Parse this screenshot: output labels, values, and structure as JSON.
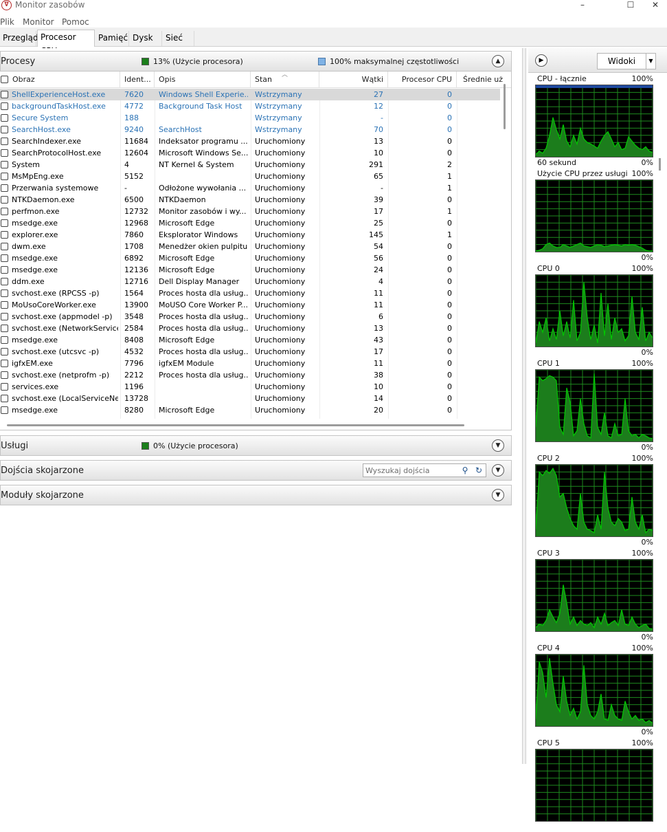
{
  "window": {
    "title": "Monitor zasobów",
    "minimize": "–",
    "maximize": "☐",
    "close": "✕",
    "icon_glyph": "∇"
  },
  "menu": [
    "Plik",
    "Monitor",
    "Pomoc"
  ],
  "tabs": [
    "Przegląd",
    "Procesor CPU",
    "Pamięć",
    "Dysk",
    "Sieć"
  ],
  "active_tab": "Procesor CPU",
  "processes": {
    "title": "Procesy",
    "cpu_usage": "13% (Użycie procesora)",
    "max_freq": "100% maksymalnej częstotliwości",
    "columns": [
      "Obraz",
      "Ident...",
      "Opis",
      "Stan",
      "Wątki",
      "Procesor CPU",
      "Średnie uż"
    ],
    "rows": [
      {
        "name": "ShellExperienceHost.exe",
        "pid": "7620",
        "desc": "Windows Shell Experie...",
        "state": "Wstrzymany",
        "threads": "27",
        "cpu": "0",
        "suspended": true,
        "selected": true
      },
      {
        "name": "backgroundTaskHost.exe",
        "pid": "4772",
        "desc": "Background Task Host",
        "state": "Wstrzymany",
        "threads": "12",
        "cpu": "0",
        "suspended": true
      },
      {
        "name": "Secure System",
        "pid": "188",
        "desc": "",
        "state": "Wstrzymany",
        "threads": "-",
        "cpu": "0",
        "suspended": true
      },
      {
        "name": "SearchHost.exe",
        "pid": "9240",
        "desc": "SearchHost",
        "state": "Wstrzymany",
        "threads": "70",
        "cpu": "0",
        "suspended": true
      },
      {
        "name": "SearchIndexer.exe",
        "pid": "11684",
        "desc": "Indeksator programu ...",
        "state": "Uruchomiony",
        "threads": "13",
        "cpu": "0"
      },
      {
        "name": "SearchProtocolHost.exe",
        "pid": "12604",
        "desc": "Microsoft Windows Se...",
        "state": "Uruchomiony",
        "threads": "10",
        "cpu": "0"
      },
      {
        "name": "System",
        "pid": "4",
        "desc": "NT Kernel & System",
        "state": "Uruchomiony",
        "threads": "291",
        "cpu": "2"
      },
      {
        "name": "MsMpEng.exe",
        "pid": "5152",
        "desc": "",
        "state": "Uruchomiony",
        "threads": "65",
        "cpu": "1"
      },
      {
        "name": "Przerwania systemowe",
        "pid": "-",
        "desc": "Odłożone wywołania ...",
        "state": "Uruchomiony",
        "threads": "-",
        "cpu": "1"
      },
      {
        "name": "NTKDaemon.exe",
        "pid": "6500",
        "desc": "NTKDaemon",
        "state": "Uruchomiony",
        "threads": "39",
        "cpu": "0"
      },
      {
        "name": "perfmon.exe",
        "pid": "12732",
        "desc": "Monitor zasobów i wy...",
        "state": "Uruchomiony",
        "threads": "17",
        "cpu": "1"
      },
      {
        "name": "msedge.exe",
        "pid": "12968",
        "desc": "Microsoft Edge",
        "state": "Uruchomiony",
        "threads": "25",
        "cpu": "0"
      },
      {
        "name": "explorer.exe",
        "pid": "7860",
        "desc": "Eksplorator Windows",
        "state": "Uruchomiony",
        "threads": "145",
        "cpu": "1"
      },
      {
        "name": "dwm.exe",
        "pid": "1708",
        "desc": "Menedżer okien pulpitu",
        "state": "Uruchomiony",
        "threads": "54",
        "cpu": "0"
      },
      {
        "name": "msedge.exe",
        "pid": "6892",
        "desc": "Microsoft Edge",
        "state": "Uruchomiony",
        "threads": "56",
        "cpu": "0"
      },
      {
        "name": "msedge.exe",
        "pid": "12136",
        "desc": "Microsoft Edge",
        "state": "Uruchomiony",
        "threads": "24",
        "cpu": "0"
      },
      {
        "name": "ddm.exe",
        "pid": "12716",
        "desc": "Dell Display Manager",
        "state": "Uruchomiony",
        "threads": "4",
        "cpu": "0"
      },
      {
        "name": "svchost.exe (RPCSS -p)",
        "pid": "1564",
        "desc": "Proces hosta dla usług...",
        "state": "Uruchomiony",
        "threads": "11",
        "cpu": "0"
      },
      {
        "name": "MoUsoCoreWorker.exe",
        "pid": "13900",
        "desc": "MoUSO Core Worker P...",
        "state": "Uruchomiony",
        "threads": "11",
        "cpu": "0"
      },
      {
        "name": "svchost.exe (appmodel -p)",
        "pid": "3548",
        "desc": "Proces hosta dla usług...",
        "state": "Uruchomiony",
        "threads": "6",
        "cpu": "0"
      },
      {
        "name": "svchost.exe (NetworkService...",
        "pid": "2584",
        "desc": "Proces hosta dla usług...",
        "state": "Uruchomiony",
        "threads": "13",
        "cpu": "0"
      },
      {
        "name": "msedge.exe",
        "pid": "8408",
        "desc": "Microsoft Edge",
        "state": "Uruchomiony",
        "threads": "43",
        "cpu": "0"
      },
      {
        "name": "svchost.exe (utcsvc -p)",
        "pid": "4532",
        "desc": "Proces hosta dla usług...",
        "state": "Uruchomiony",
        "threads": "17",
        "cpu": "0"
      },
      {
        "name": "igfxEM.exe",
        "pid": "7796",
        "desc": "igfxEM Module",
        "state": "Uruchomiony",
        "threads": "11",
        "cpu": "0"
      },
      {
        "name": "svchost.exe (netprofm -p)",
        "pid": "2212",
        "desc": "Proces hosta dla usług...",
        "state": "Uruchomiony",
        "threads": "38",
        "cpu": "0"
      },
      {
        "name": "services.exe",
        "pid": "1196",
        "desc": "",
        "state": "Uruchomiony",
        "threads": "10",
        "cpu": "0"
      },
      {
        "name": "svchost.exe (LocalServiceNet...",
        "pid": "13728",
        "desc": "",
        "state": "Uruchomiony",
        "threads": "14",
        "cpu": "0"
      },
      {
        "name": "msedge.exe",
        "pid": "8280",
        "desc": "Microsoft Edge",
        "state": "Uruchomiony",
        "threads": "20",
        "cpu": "0"
      }
    ]
  },
  "services": {
    "title": "Usługi",
    "cpu_usage": "0% (Użycie procesora)"
  },
  "handles": {
    "title": "Dojścia skojarzone",
    "search_placeholder": "Wyszukaj dojścia"
  },
  "modules": {
    "title": "Moduły skojarzone"
  },
  "right": {
    "views_label": "Widoki",
    "graphs": [
      {
        "title": "CPU - łącznie",
        "max": "100%",
        "min": "0%",
        "sub": "60 sekund",
        "values": [
          3,
          8,
          5,
          12,
          30,
          55,
          38,
          25,
          45,
          22,
          14,
          30,
          18,
          40,
          25,
          20,
          18,
          15,
          12,
          22,
          30,
          35,
          25,
          14,
          20,
          10,
          12,
          28,
          22,
          16,
          12,
          10,
          14,
          8,
          6
        ]
      },
      {
        "title": "Użycie CPU przez usługi",
        "max": "100%",
        "min": "0%",
        "values": [
          1,
          2,
          4,
          10,
          12,
          8,
          6,
          6,
          10,
          8,
          6,
          8,
          10,
          12,
          8,
          7,
          6,
          8,
          10,
          9,
          7,
          8,
          9,
          10,
          9,
          8,
          10,
          9,
          10,
          9,
          7,
          5,
          2,
          1,
          1
        ]
      },
      {
        "title": "CPU 0",
        "max": "100%",
        "min": "0%",
        "values": [
          5,
          35,
          20,
          40,
          8,
          25,
          10,
          50,
          15,
          35,
          12,
          65,
          8,
          20,
          90,
          40,
          10,
          30,
          5,
          75,
          15,
          60,
          10,
          40,
          20,
          25,
          8,
          15,
          70,
          20,
          10,
          55,
          8,
          20,
          12
        ]
      },
      {
        "title": "CPU 1",
        "max": "100%",
        "min": "0%",
        "values": [
          20,
          90,
          85,
          88,
          92,
          90,
          85,
          20,
          10,
          75,
          55,
          8,
          15,
          60,
          25,
          8,
          5,
          95,
          20,
          10,
          40,
          8,
          5,
          25,
          8,
          10,
          60,
          15,
          8,
          10,
          5,
          10,
          8,
          5,
          4
        ]
      },
      {
        "title": "CPU 2",
        "max": "100%",
        "min": "0%",
        "values": [
          10,
          90,
          85,
          92,
          88,
          95,
          85,
          55,
          60,
          40,
          25,
          15,
          10,
          60,
          20,
          10,
          8,
          5,
          30,
          10,
          90,
          40,
          20,
          15,
          25,
          20,
          8,
          10,
          55,
          20,
          10,
          30,
          5,
          10,
          8
        ]
      },
      {
        "title": "CPU 3",
        "max": "100%",
        "min": "0%",
        "values": [
          5,
          10,
          8,
          15,
          30,
          20,
          12,
          25,
          65,
          40,
          10,
          20,
          8,
          15,
          10,
          8,
          12,
          5,
          20,
          10,
          25,
          8,
          12,
          15,
          8,
          30,
          10,
          8,
          20,
          10,
          5,
          8,
          10,
          4,
          3
        ]
      },
      {
        "title": "CPU 4",
        "max": "100%",
        "min": "0%",
        "values": [
          10,
          90,
          75,
          40,
          95,
          60,
          30,
          20,
          70,
          35,
          15,
          25,
          10,
          20,
          85,
          30,
          15,
          10,
          20,
          45,
          10,
          8,
          30,
          15,
          10,
          8,
          35,
          20,
          10,
          15,
          8,
          10,
          5,
          8,
          4
        ]
      },
      {
        "title": "CPU 5",
        "max": "100%",
        "min": "0%",
        "values": []
      }
    ]
  },
  "colors": {
    "graph_line": "#00c800",
    "graph_fill": "#1c7d1c",
    "graph_grid": "#1e8a1e",
    "graph_total_bar": "#1f4aa0",
    "link_blue": "#2a72b5"
  }
}
